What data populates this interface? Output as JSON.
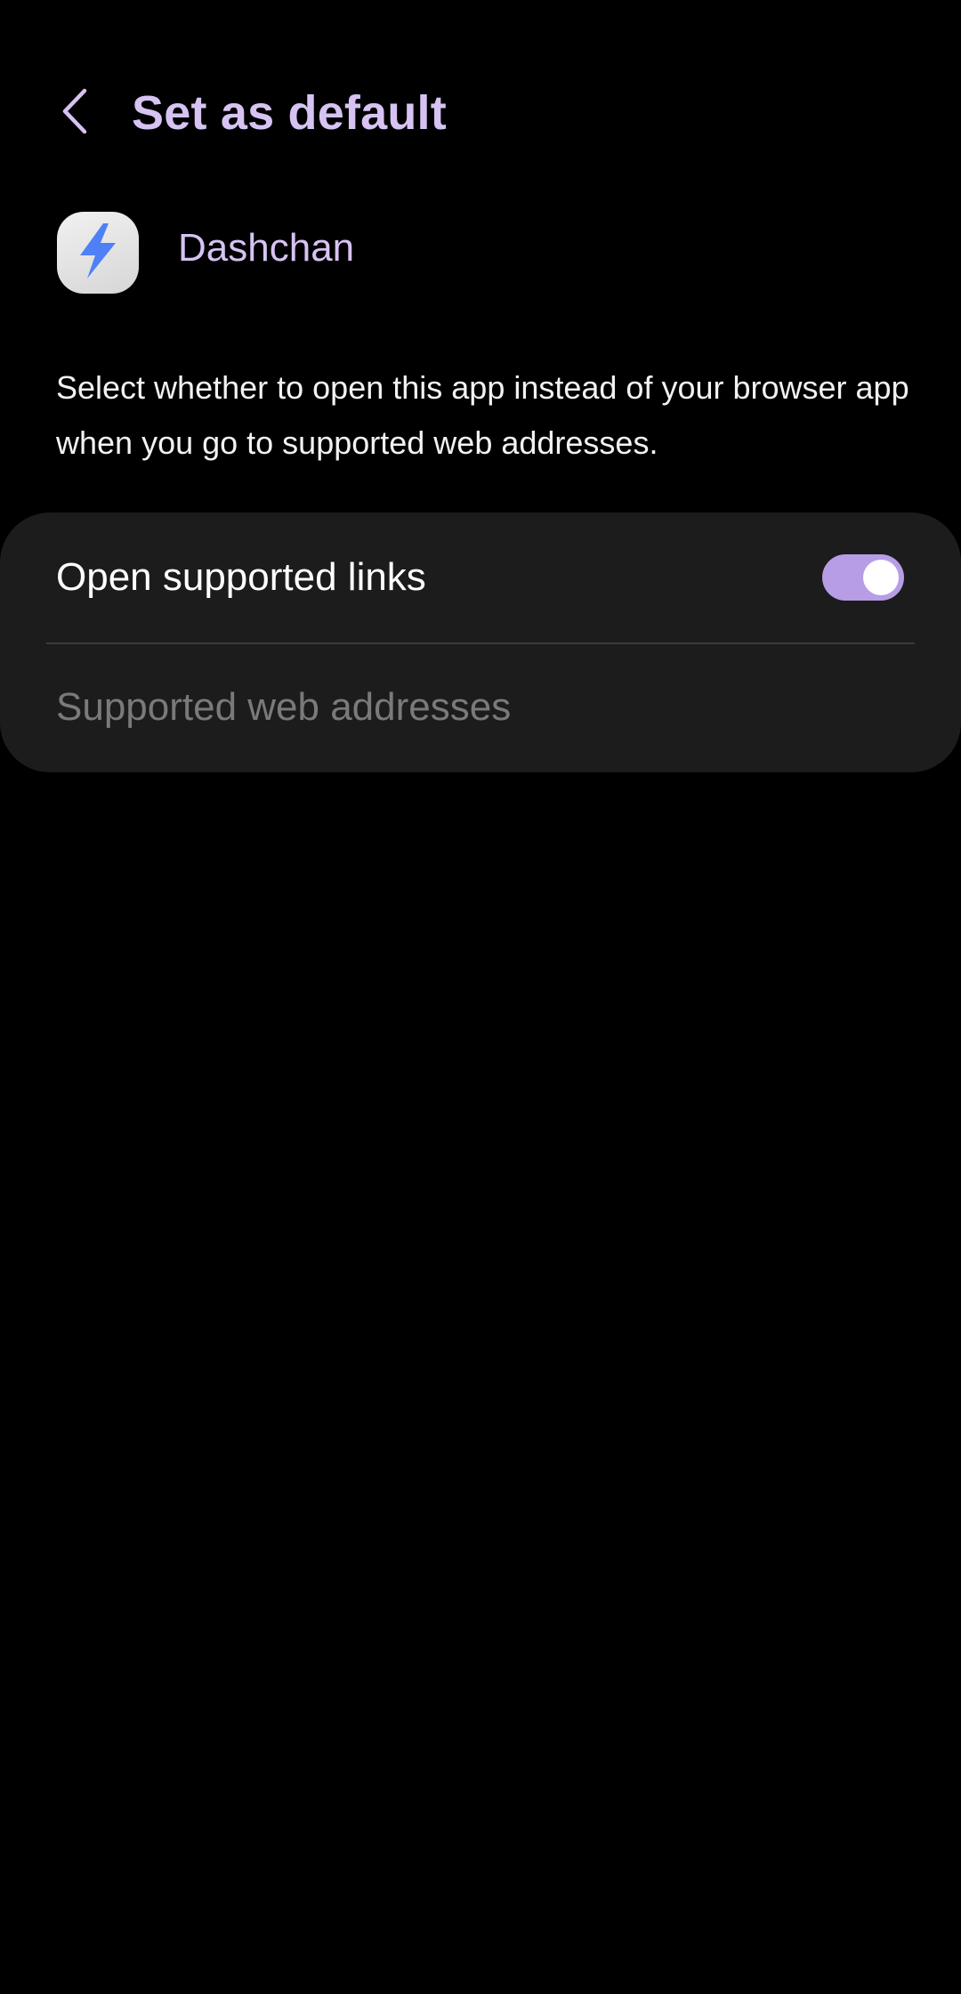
{
  "header": {
    "title": "Set as default",
    "back_icon": "chevron-left-icon"
  },
  "app": {
    "name": "Dashchan",
    "icon": "lightning-bolt-icon"
  },
  "description": "Select whether to open this app instead of your browser app when you go to supported web addresses.",
  "settings": {
    "open_supported_links": {
      "label": "Open supported links",
      "enabled": true
    },
    "supported_web_addresses": {
      "label": "Supported web addresses",
      "enabled": false
    }
  },
  "colors": {
    "accent": "#d6c3f2",
    "toggle_on": "#b79de6",
    "background": "#000000",
    "card": "#1c1c1c",
    "bolt": "#4f80f7"
  }
}
